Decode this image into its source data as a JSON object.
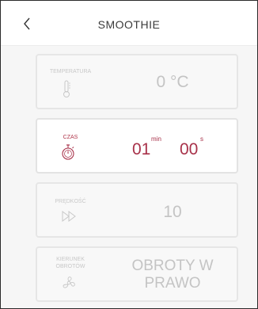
{
  "header": {
    "title": "SMOOTHIE"
  },
  "cards": [
    {
      "label": "TEMPERATURA",
      "value": "0 °C",
      "icon": "thermometer-icon",
      "active": false
    },
    {
      "label": "CZAS",
      "minutes": "01",
      "minutes_unit": "min",
      "seconds": "00",
      "seconds_unit": "s",
      "icon": "stopwatch-icon",
      "active": true
    },
    {
      "label": "PRĘDKOŚĆ",
      "value": "10",
      "icon": "fast-forward-icon",
      "active": false
    },
    {
      "label": "KIERUNEK OBROTÓW",
      "value_line1": "OBROTY W",
      "value_line2": "PRAWO",
      "icon": "fan-icon",
      "active": false
    }
  ],
  "colors": {
    "accent": "#a8324a",
    "inactive": "#c4c4c4",
    "background": "#f6f6f6"
  }
}
